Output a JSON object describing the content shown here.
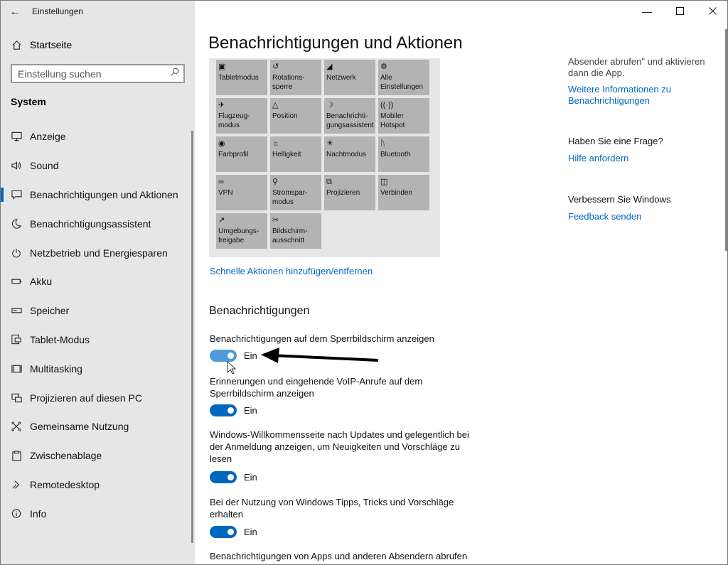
{
  "window": {
    "title": "Einstellungen"
  },
  "sidebar": {
    "home_label": "Startseite",
    "search_placeholder": "Einstellung suchen",
    "section_label": "System",
    "items": [
      {
        "label": "Anzeige",
        "icon": "monitor-icon"
      },
      {
        "label": "Sound",
        "icon": "speaker-icon"
      },
      {
        "label": "Benachrichtigungen und Aktionen",
        "icon": "notification-icon",
        "active": true
      },
      {
        "label": "Benachrichtigungsassistent",
        "icon": "moon-icon"
      },
      {
        "label": "Netzbetrieb und Energiesparen",
        "icon": "power-icon"
      },
      {
        "label": "Akku",
        "icon": "battery-icon"
      },
      {
        "label": "Speicher",
        "icon": "storage-icon"
      },
      {
        "label": "Tablet-Modus",
        "icon": "tablet-icon"
      },
      {
        "label": "Multitasking",
        "icon": "multitasking-icon"
      },
      {
        "label": "Projizieren auf diesen PC",
        "icon": "project-icon"
      },
      {
        "label": "Gemeinsame Nutzung",
        "icon": "share-icon"
      },
      {
        "label": "Zwischenablage",
        "icon": "clipboard-icon"
      },
      {
        "label": "Remotedesktop",
        "icon": "remote-icon"
      },
      {
        "label": "Info",
        "icon": "info-icon"
      }
    ]
  },
  "main": {
    "title": "Benachrichtigungen und Aktionen",
    "quick_actions": [
      {
        "label": "Tabletmodus",
        "icon": "tablet-mode-icon"
      },
      {
        "label": "Rotations-\nsperre",
        "icon": "rotation-lock-icon"
      },
      {
        "label": "Netzwerk",
        "icon": "network-icon"
      },
      {
        "label": "Alle\nEinstellungen",
        "icon": "settings-icon"
      },
      {
        "label": "Flugzeug-\nmodus",
        "icon": "airplane-icon"
      },
      {
        "label": "Position",
        "icon": "location-icon"
      },
      {
        "label": "Benachrichti-\ngungsassistent",
        "icon": "focus-assist-icon"
      },
      {
        "label": "Mobiler\nHotspot",
        "icon": "hotspot-icon"
      },
      {
        "label": "Farbprofil",
        "icon": "color-profile-icon"
      },
      {
        "label": "Helligkeit",
        "icon": "brightness-icon"
      },
      {
        "label": "Nachtmodus",
        "icon": "night-light-icon"
      },
      {
        "label": "Bluetooth",
        "icon": "bluetooth-icon"
      },
      {
        "label": "VPN",
        "icon": "vpn-icon"
      },
      {
        "label": "Stromspar-\nmodus",
        "icon": "battery-saver-icon"
      },
      {
        "label": "Projizieren",
        "icon": "project-icon"
      },
      {
        "label": "Verbinden",
        "icon": "connect-icon"
      },
      {
        "label": "Umgebungs-\nfreigabe",
        "icon": "nearby-share-icon"
      },
      {
        "label": "Bildschirm-\nausschnitt",
        "icon": "snip-icon"
      }
    ],
    "quick_actions_link": "Schnelle Aktionen hinzufügen/entfernen",
    "notifications_heading": "Benachrichtigungen",
    "settings": [
      {
        "label": "Benachrichtigungen auf dem Sperrbildschirm anzeigen",
        "state": "Ein"
      },
      {
        "label": "Erinnerungen und eingehende VoIP-Anrufe auf dem Sperrbildschirm anzeigen",
        "state": "Ein"
      },
      {
        "label": "Windows-Willkommensseite nach Updates und gelegentlich bei der Anmeldung anzeigen, um Neuigkeiten und Vorschläge zu lesen",
        "state": "Ein"
      },
      {
        "label": "Bei der Nutzung von Windows Tipps, Tricks und Vorschläge erhalten",
        "state": "Ein"
      },
      {
        "label": "Benachrichtigungen von Apps und anderen Absendern abrufen"
      }
    ]
  },
  "right": {
    "info_text": "Absender abrufen\" und aktivieren dann die App.",
    "info_link": "Weitere Informationen zu Benachrichtigungen",
    "question_heading": "Haben Sie eine Frage?",
    "help_link": "Hilfe anfordern",
    "improve_heading": "Verbessern Sie Windows",
    "feedback_link": "Feedback senden"
  },
  "colors": {
    "accent": "#0067c0",
    "sidebar_bg": "#e6e6e6",
    "tile_bg": "#b3b3b3"
  }
}
